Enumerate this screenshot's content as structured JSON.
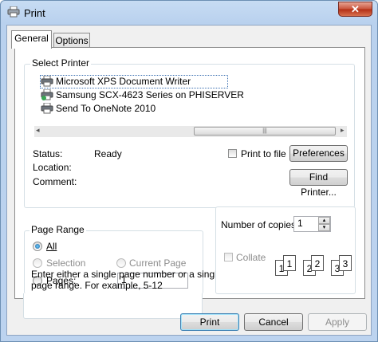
{
  "window": {
    "title": "Print",
    "close_glyph": "✕"
  },
  "tabs": [
    {
      "label": "General",
      "active": true
    },
    {
      "label": "Options",
      "active": false
    }
  ],
  "select_printer": {
    "label": "Select Printer",
    "printers": [
      {
        "name": "Microsoft XPS Document Writer",
        "selected": true,
        "icon": "printer-icon"
      },
      {
        "name": "Samsung SCX-4623 Series on PHISERVER",
        "selected": false,
        "icon": "network-printer-icon"
      },
      {
        "name": "Send To OneNote 2010",
        "selected": false,
        "icon": "printer-icon"
      }
    ],
    "scroll_left": "◂",
    "scroll_right": "▸",
    "scroll_grip": "|||",
    "status_label": "Status:",
    "status_value": "Ready",
    "location_label": "Location:",
    "location_value": "",
    "comment_label": "Comment:",
    "comment_value": "",
    "print_to_file_label": "Print to file",
    "print_to_file_checked": false,
    "preferences_button": "Preferences",
    "find_printer_button": "Find Printer..."
  },
  "page_range": {
    "label": "Page Range",
    "all_label": "All",
    "selection_label": "Selection",
    "current_page_label": "Current Page",
    "pages_label": "Pages:",
    "pages_value": "1",
    "selected": "all",
    "help_text_line1": "Enter either a single page number or a single",
    "help_text_line2": "page range.  For example, 5-12"
  },
  "copies": {
    "label": "Number of copies:",
    "value": "1",
    "collate_label": "Collate",
    "collate_checked": false,
    "spin_up": "▴",
    "spin_down": "▾",
    "collate_pages": [
      "1",
      "1",
      "2",
      "2",
      "3",
      "3"
    ]
  },
  "buttons": {
    "print": "Print",
    "cancel": "Cancel",
    "apply": "Apply"
  },
  "colors": {
    "selection_border": "#7da2ce",
    "window_frame": "#b9d1ee",
    "close_button": "#c8523a"
  }
}
